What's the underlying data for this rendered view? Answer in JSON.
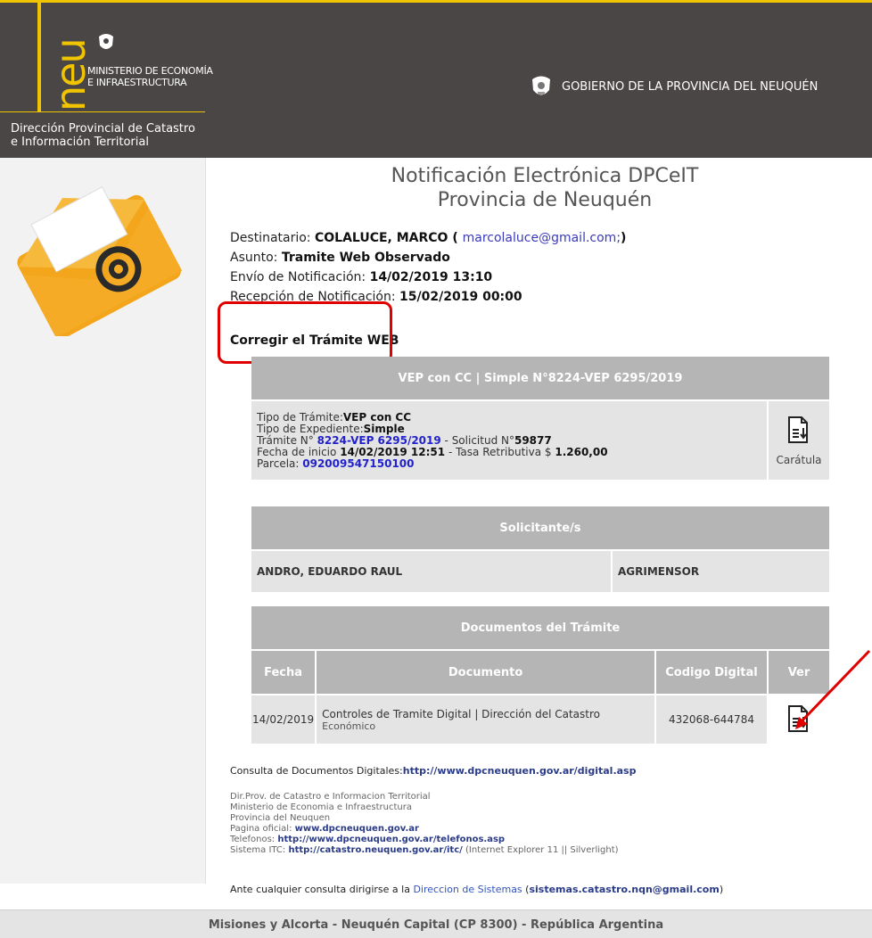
{
  "header": {
    "ministerio": [
      "MINISTERIO DE ECONOMÍA",
      "E INFRAESTRUCTURA"
    ],
    "dpc": [
      "Dirección Provincial de Catastro",
      "e Información Territorial"
    ],
    "gobierno": "GOBIERNO DE LA PROVINCIA DEL NEUQUÉN",
    "logo_text": "neu",
    "brand_color": "#f0c400",
    "bg_color": "#4a4645"
  },
  "title": {
    "line1": "Notificación Electrónica DPCeIT",
    "line2": "Provincia de Neuquén"
  },
  "meta": {
    "destinatario_label": "Destinatario: ",
    "destinatario_name": "COLALUCE, MARCO",
    "destinatario_open": " ( ",
    "destinatario_email": "marcolaluce@gmail.com;",
    "destinatario_close": ")",
    "asunto_label": "Asunto: ",
    "asunto_value": "Tramite Web Observado",
    "envio_label": "Envío de Notificación: ",
    "envio_value": "14/02/2019 13:10",
    "recepcion_label": "Recepción de Notificación: ",
    "recepcion_value": "15/02/2019 00:00",
    "corregir": "Corregir el Trámite WEB"
  },
  "tramite": {
    "header": "VEP con CC | Simple N°8224-VEP 6295/2019",
    "tipo_tramite_label": "Tipo de Trámite:",
    "tipo_tramite_value": "VEP con CC",
    "tipo_exp_label": "Tipo de Expediente:",
    "tipo_exp_value": "Simple",
    "tramite_label": "Trámite N° ",
    "tramite_value": "8224-VEP 6295/2019",
    "solicitud_label": " - Solicitud N°",
    "solicitud_value": "59877",
    "fecha_label": "Fecha de inicio ",
    "fecha_value": "14/02/2019 12:51",
    "tasa_label": " - Tasa Retributiva $ ",
    "tasa_value": "1.260,00",
    "parcela_label": "Parcela: ",
    "parcela_value": "092009547150100",
    "caratula": "Carátula"
  },
  "solicitantes": {
    "header": "Solicitante/s",
    "rows": [
      {
        "name": "ANDRO, EDUARDO RAUL",
        "role": "AGRIMENSOR"
      }
    ]
  },
  "documentos": {
    "header": "Documentos del Trámite",
    "columns": [
      "Fecha",
      "Documento",
      "Codigo Digital",
      "Ver"
    ],
    "rows": [
      {
        "fecha": "14/02/2019",
        "documento": "Controles de Tramite Digital | Dirección del Catastro",
        "documento_sub": "Económico",
        "codigo": "432068-644784"
      }
    ]
  },
  "consulta": {
    "label": "Consulta de Documentos Digitales:",
    "url": "http://www.dpcneuquen.gov.ar/digital.asp"
  },
  "footer_info": {
    "line1": "Dir.Prov. de Catastro e Informacion Territorial",
    "line2": "Ministerio de Economia e Infraestructura",
    "line3": "Provincia del Neuquen",
    "pagina_label": "Pagina oficial: ",
    "pagina_url": "www.dpcneuquen.gov.ar",
    "tel_label": "Telefonos: ",
    "tel_url": "http://www.dpcneuquen.gov.ar/telefonos.asp",
    "itc_label": "Sistema ITC: ",
    "itc_url": "http://catastro.neuquen.gov.ar/itc/",
    "itc_note": " (Internet Explorer 11 || Silverlight)"
  },
  "ante": {
    "text": "Ante cualquier consulta dirigirse a la ",
    "link": "Direccion de Sistemas",
    "open": " (",
    "email": "sistemas.catastro.nqn@gmail.com",
    "close": ")"
  },
  "bottom": "Misiones y Alcorta - Neuquén Capital (CP 8300) - República Argentina",
  "annotation_color": "#e00000"
}
